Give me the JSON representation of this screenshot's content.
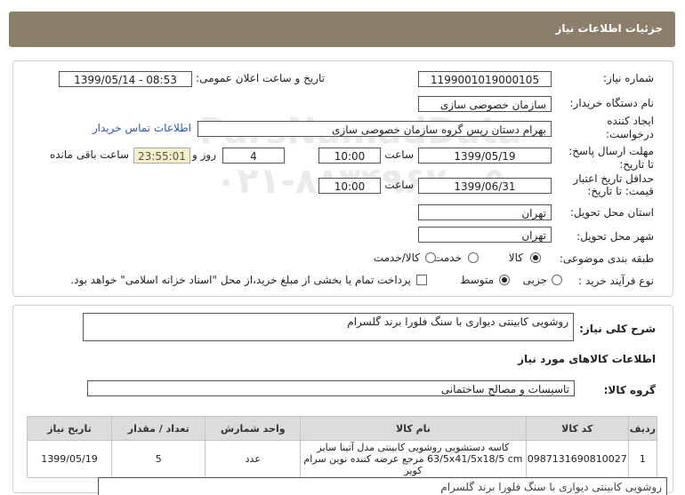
{
  "header": {
    "title": "جزئیات اطلاعات نیاز"
  },
  "watermark": {
    "line1": "ParsNamadData",
    "line2": "۰۲۱-۸۸۳۴۹۶۷۰-۵"
  },
  "fields": {
    "need_number_label": "شماره نیاز:",
    "need_number": "1199001019000105",
    "announce_label": "تاریخ و ساعت اعلان عمومی:",
    "announce_value": "1399/05/14 - 08:53",
    "buyer_org_label": "نام دستگاه خریدار:",
    "buyer_org": "سازمان خصوصی سازی",
    "creator_label_1": "ایجاد کننده",
    "creator_label_2": "درخواست:",
    "creator": "بهرام دستان رپس گروه سازمان خصوصی سازی",
    "contact_link": "اطلاعات تماس خریدار",
    "deadline_label_1": "مهلت ارسال پاسخ:",
    "deadline_label_2": "تا تاریخ:",
    "deadline_date": "1399/05/19",
    "time_label": "ساعت",
    "deadline_time": "10:00",
    "days_value": "4",
    "days_label": "روز و",
    "remaining_time": "23:55:01",
    "remaining_label": "ساعت باقی مانده",
    "validity_label_1": "حداقل تاریخ اعتبار",
    "validity_label_2": "قیمت: تا تاریخ:",
    "validity_date": "1399/06/31",
    "validity_time": "10:00",
    "province_label": "استان محل تحویل:",
    "province": "تهران",
    "city_label": "شهر محل تحویل:",
    "city": "تهران",
    "category_label": "طبقه بندی موضوعی:",
    "cat_goods": "کالا",
    "cat_service": "خدمت",
    "cat_goods_service": "کالا/خدمت",
    "process_label": "نوع فرآیند خرید :",
    "proc_small": "جزیی",
    "proc_medium": "متوسط",
    "payment_note": "پرداخت تمام یا بخشی از مبلغ خرید،از محل \"اسناد خزانه اسلامی\" خواهد بود."
  },
  "description": {
    "label": "شرح کلی نیاز:",
    "text": "روشویی کابینتی دیواری با سنگ فلورا برند گلسرام"
  },
  "goods_section": {
    "title": "اطلاعات کالاهای مورد نیاز",
    "group_label": "گروه کالا:",
    "group_value": "تاسیسات و مصالح ساختمانی"
  },
  "table": {
    "headers": [
      "ردیف",
      "کد کالا",
      "نام کالا",
      "واحد شمارش",
      "تعداد / مقدار",
      "تاریخ نیاز"
    ],
    "rows": [
      {
        "row": "1",
        "code": "0987131690810027",
        "name_line1": "کاسه دستشویی روشویی کابینتی مدل آتینا سایز",
        "name_line2": "63/5x41/5x18/5 cm مرجع عرضه کننده نوین سرام کویر",
        "unit": "عدد",
        "qty": "5",
        "date": "1399/05/19"
      }
    ]
  },
  "bottom_text": "روشویی کابینتی دیواری با سنگ فلورا برند گلسرام"
}
